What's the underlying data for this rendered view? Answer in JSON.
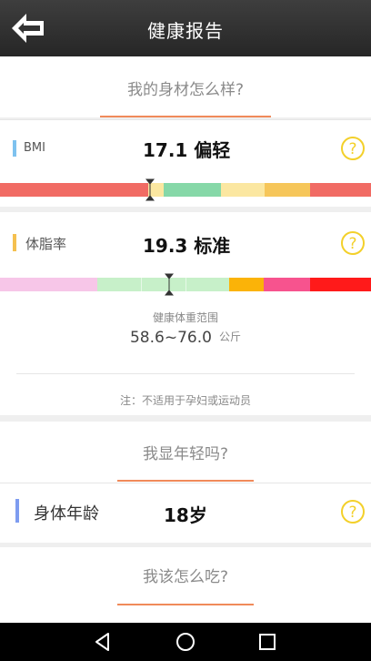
{
  "header": {
    "title": "健康报告",
    "back_icon": "arrow-left-icon"
  },
  "section1": {
    "heading": "我的身材怎么样?"
  },
  "bmi": {
    "label": "BMI",
    "value_text": "17.1 偏轻",
    "value": 17.1,
    "accent_color": "#7ec2ef",
    "segments": [
      {
        "color": "#f16b64",
        "share": 0.4
      },
      {
        "color": "#fbe7a1",
        "share": 0.04
      },
      {
        "color": "#86d8a8",
        "share": 0.155
      },
      {
        "color": "#fbe7a1",
        "share": 0.118
      },
      {
        "color": "#f6c65a",
        "share": 0.122
      },
      {
        "color": "#f16b64",
        "share": 0.165
      }
    ],
    "marker_position": 0.405
  },
  "bodyfat": {
    "label": "体脂率",
    "value_text": "19.3 标准",
    "value": 19.3,
    "accent_color": "#f5c04f",
    "segments": [
      {
        "color": "#f7c6e8",
        "share": 0.262
      },
      {
        "color": "#c7f0c9",
        "share": 0.355
      },
      {
        "color": "#fbb308",
        "share": 0.093
      },
      {
        "color": "#f7538e",
        "share": 0.125
      },
      {
        "color": "#ff1a1a",
        "share": 0.165
      }
    ],
    "marker_position": 0.457,
    "weight_range_label": "健康体重范围",
    "weight_range": "58.6~76.0",
    "weight_unit": "公斤",
    "note": "注：不适用于孕妇或运动员"
  },
  "section2": {
    "heading": "我显年轻吗?"
  },
  "body_age": {
    "label": "身体年龄",
    "value_text": "18岁",
    "accent_color": "#7e9cf0"
  },
  "section3": {
    "heading": "我该怎么吃?"
  },
  "help_icon": "question-mark-circle-icon",
  "colors": {
    "help_yellow": "#f3d02a",
    "underline": "#f08a5a"
  },
  "navbar": {
    "icons": [
      "back-triangle-icon",
      "home-circle-icon",
      "recents-square-icon"
    ]
  }
}
